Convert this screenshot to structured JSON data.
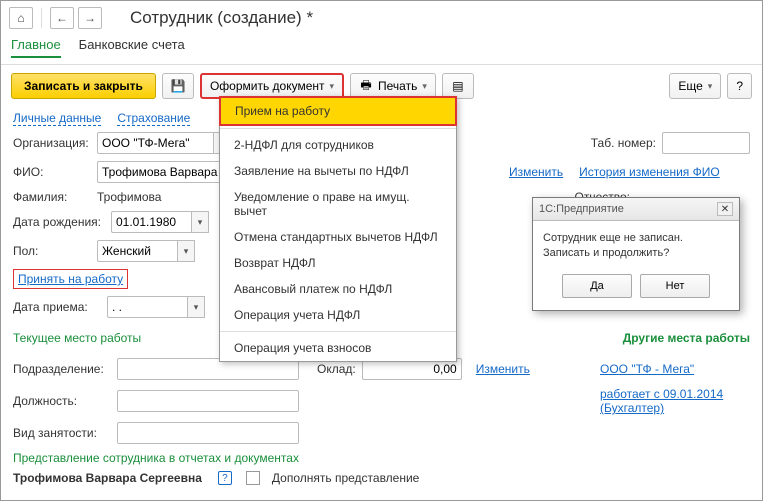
{
  "window": {
    "title": "Сотрудник (создание) *"
  },
  "tabs": {
    "main": "Главное",
    "bank": "Банковские счета"
  },
  "toolbar": {
    "save_close": "Записать и закрыть",
    "format_doc": "Оформить документ",
    "print": "Печать",
    "more": "Еще",
    "help": "?"
  },
  "dropdown": {
    "items": [
      "Прием на работу",
      "2-НДФЛ для сотрудников",
      "Заявление на вычеты по НДФЛ",
      "Уведомление о праве на имущ. вычет",
      "Отмена стандартных вычетов НДФЛ",
      "Возврат НДФЛ",
      "Авансовый платеж по НДФЛ",
      "Операция учета НДФЛ",
      "Операция учета взносов"
    ]
  },
  "section_tabs": {
    "personal": "Личные данные",
    "insurance": "Страхование"
  },
  "labels": {
    "org": "Организация:",
    "tabno": "Таб. номер:",
    "fio": "ФИО:",
    "change": "Изменить",
    "fio_history": "История изменения ФИО",
    "surname": "Фамилия:",
    "patronymic": "Отчество:",
    "dob": "Дата рождения:",
    "sex": "Пол:",
    "hire": "Принять на работу",
    "hire_date": "Дата приема:",
    "curplace": "Текущее место работы",
    "other_places": "Другие места работы",
    "dept": "Подразделение:",
    "salary": "Оклад:",
    "position": "Должность:",
    "emp_type": "Вид занятости:",
    "rep_header": "Представление сотрудника в отчетах и документах",
    "rep_chk": "Дополнять представление"
  },
  "values": {
    "org": "ООО \"ТФ-Мега\"",
    "fio": "Трофимова Варвара С",
    "surname": "Трофимова",
    "dob": "01.01.1980",
    "sex": "Женский",
    "hire_date": ". .",
    "salary": "0,00",
    "other_org": "ООО \"ТФ - Мега\"",
    "other_since": "работает с 09.01.2014",
    "other_pos": "(Бухгалтер)",
    "rep_name": "Трофимова Варвара Сергеевна"
  },
  "modal": {
    "title": "1С:Предприятие",
    "line1": "Сотрудник еще не записан.",
    "line2": "Записать и продолжить?",
    "yes": "Да",
    "no": "Нет"
  }
}
